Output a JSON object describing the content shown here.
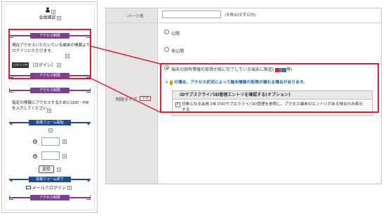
{
  "phone": {
    "title": "会員確認",
    "access_bar_1": "アクセス制限",
    "login_notice": "現在アクセスいただいている端末の情報よりログインいただけます。",
    "login_badge": "ログイン中",
    "login_link": "［ログイン］",
    "access_bar_2": "アクセス制限",
    "access_bar_3": "アクセス制限",
    "id_pw_notice": "指定の情報にアクセスするためにはID・PWを入力してください。",
    "form_start_bar": "投稿フォーム開始",
    "field_1_icon": "①",
    "field_2_icon": "②",
    "send_button": "送信",
    "form_end_bar": "投稿フォーム終了",
    "mail_login": "メールでログイン",
    "access_bar_4": "アクセス制限"
  },
  "settings": {
    "parts_name_label": "パーツ名",
    "parts_name_value": "",
    "parts_name_hint": "(半角30文字以内)",
    "restriction_label": "制限タイプ",
    "required_badge": "必須",
    "option_public": "公開",
    "option_private": "非公開",
    "option_terminal": "端末の固有情報の取得が既に完了している端末に限定(",
    "option_terminal_suffix": "等)",
    "warning_text": "の場合、アクセス状況によって端末情報の取得が遅れる場合があります。",
    "option_box_title": "IDサブスクライバID管理エントリを確認する(オプション)",
    "option_box_text": "対象となる会員 DB のIDサブスクライバID管理を参照し、アクセス端末のエントリがある場合のみ表示する"
  }
}
